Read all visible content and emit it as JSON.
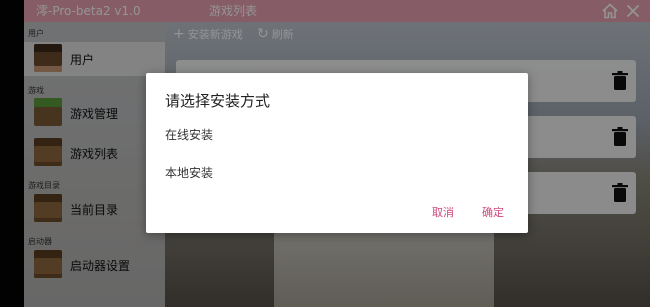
{
  "window": {
    "app_title": "澪-Pro-beta2 v1.0",
    "page_title": "游戏列表",
    "home_icon": "home-icon",
    "close_icon": "close-icon",
    "accent_color": "#e79fb2"
  },
  "sidebar": {
    "sections": [
      {
        "label": "用户",
        "items": [
          {
            "label": "用户",
            "icon": "steve-head-icon"
          }
        ]
      },
      {
        "label": "游戏",
        "items": [
          {
            "label": "游戏管理",
            "icon": "grass-block-icon"
          },
          {
            "label": "游戏列表",
            "icon": "crafting-table-icon"
          }
        ]
      },
      {
        "label": "游戏目录",
        "items": [
          {
            "label": "当前目录",
            "icon": "crafting-table-icon"
          }
        ]
      },
      {
        "label": "启动器",
        "items": [
          {
            "label": "启动器设置",
            "icon": "crafting-table-icon"
          }
        ]
      }
    ]
  },
  "toolbar": {
    "install_label": "安装新游戏",
    "refresh_label": "刷新"
  },
  "dialog": {
    "title": "请选择安装方式",
    "options": [
      "在线安装",
      "本地安装"
    ],
    "cancel_label": "取消",
    "confirm_label": "确定",
    "button_color": "#d0487a"
  }
}
